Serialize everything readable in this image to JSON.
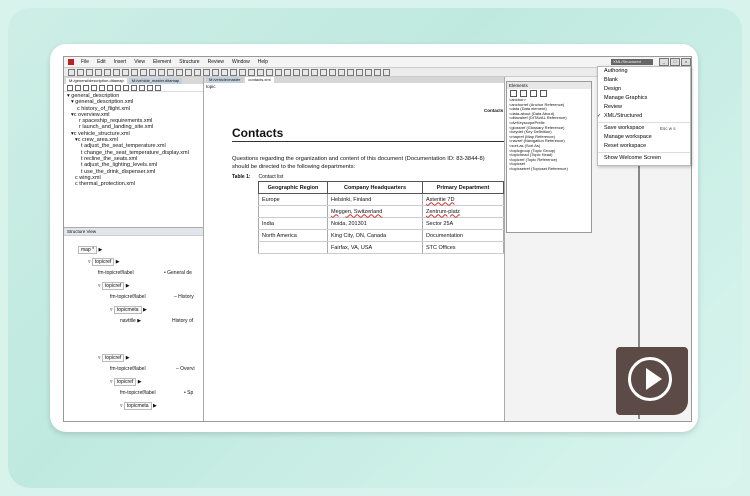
{
  "menubar": [
    "File",
    "Edit",
    "Insert",
    "View",
    "Element",
    "Structure",
    "Review",
    "Window",
    "Help"
  ],
  "toolbar": {
    "dropdown_value": "XML/Structured"
  },
  "left_tabs": [
    "M:/general/description.ditamap",
    "M:/vehicle_master.ditamap"
  ],
  "map_tree": [
    "general_description",
    "general_description.xml",
    "history_of_flight.xml",
    "overview.xml",
    "spaceship_requirements.xml",
    "launch_and_landing_site.xml",
    "vehicle_structure.xml",
    "crew_area.xml",
    "adjust_the_seat_temperature.xml",
    "change_the_seat_temperature_display.xml",
    "recline_the_seats.xml",
    "adjust_the_lighting_levels.xml",
    "use_the_drink_dispenser.xml",
    "wing.xml",
    "thermal_protection.xml"
  ],
  "structure_view": {
    "title": "Structure View",
    "nodes": [
      "map *",
      "topicref",
      "fm-topicref/label",
      "• General de",
      "topicref",
      "fm-topicref/label",
      "– History",
      "topicmeta",
      "navtitle",
      "History of",
      "topicref",
      "fm-topicref/label",
      "– Overvi",
      "topicref",
      "fm-topicref/label",
      "• Sp",
      "topicmeta"
    ]
  },
  "editor": {
    "tabs": [
      "M:/vehicle/master",
      "contacts.xml"
    ],
    "breadcrumb": "topic",
    "header_label": "Contacts",
    "title": "Contacts",
    "paragraph": "Questions regarding the organization and content of this document (Documentation ID: 83-3844-8) should be directed to the following departments:",
    "table_label": "Table 1:",
    "table_caption": "Contact list",
    "columns": [
      "Geographic Region",
      "Company Headquarters",
      "Primary Department"
    ],
    "rows": [
      [
        "Europe",
        "Helsinki, Finland",
        "Asteritie 7D"
      ],
      [
        "",
        "Meggen, Switzerland",
        "Zentrum-platz"
      ],
      [
        "India",
        "Noida, 201301",
        "Sector 25A"
      ],
      [
        "North America",
        "King City, ON, Canada",
        "Documentation"
      ],
      [
        "",
        "Fairfax, VA, USA",
        "STC Offices"
      ]
    ]
  },
  "elements_panel": {
    "title": "Elements",
    "items": [
      "<anchor>",
      "<anchorref (Anchor Reference)",
      "<data (Data element)",
      "<data-about (Data About)",
      "<ditavalref (DITAVAL Reference)",
      "<dvrKeyscopePrefix",
      "<glossref (Glossary Reference)",
      "<keydef (Key Definition)",
      "<mapref (Map Reference)",
      "<navref (Navigation Reference)",
      "<sort-as (Sort As)",
      "<topicgroup (Topic Group)",
      "<topichead (Topic Head)",
      "<topicref (Topic Reference)",
      "<topicset",
      "<topicsetref (Topicset Reference)"
    ]
  },
  "workspace_menu": {
    "items": [
      "Authoring",
      "Blank",
      "Design",
      "Manage Graphics",
      "Review",
      "XML/Structured",
      "Save workspace",
      "Manage workspace",
      "Reset workspace",
      "Show Welcome Screen"
    ],
    "checked": "XML/Structured",
    "save_shortcut": "Esc w s"
  },
  "colors": {
    "background": "#d7f3ec",
    "play_button": "#5c4a46"
  },
  "icons": [
    "play-icon",
    "app-icon"
  ]
}
